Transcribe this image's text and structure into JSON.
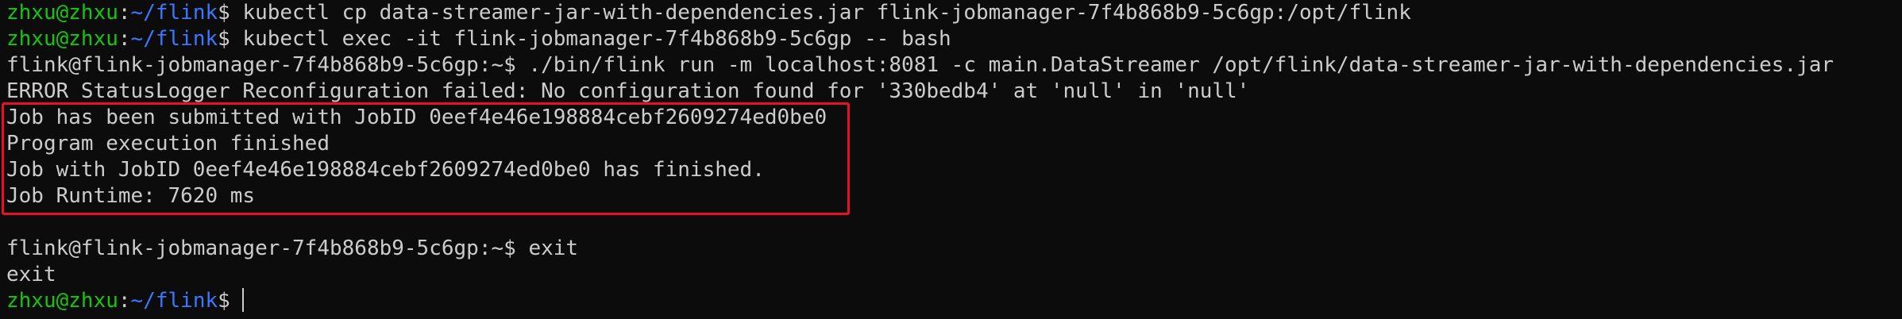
{
  "colors": {
    "background": "#0c0c0c",
    "text": "#cccccc",
    "prompt_user": "#16c60c",
    "prompt_path": "#3b78ff",
    "highlight_border": "#e81123"
  },
  "local_prompt": {
    "user": "zhxu@zhxu",
    "colon": ":",
    "path": "~/flink",
    "symbol": "$ "
  },
  "pod_prompt": "flink@flink-jobmanager-7f4b868b9-5c6gp:~$ ",
  "lines": {
    "l1_cmd": "kubectl cp data-streamer-jar-with-dependencies.jar flink-jobmanager-7f4b868b9-5c6gp:/opt/flink",
    "l2_cmd": "kubectl exec -it flink-jobmanager-7f4b868b9-5c6gp -- bash",
    "l3_cmd": "./bin/flink run -m localhost:8081 -c main.DataStreamer /opt/flink/data-streamer-jar-with-dependencies.jar",
    "l4_error": "ERROR StatusLogger Reconfiguration failed: No configuration found for '330bedb4' at 'null' in 'null'",
    "l5_submitted": "Job has been submitted with JobID 0eef4e46e198884cebf2609274ed0be0",
    "l6_finished": "Program execution finished",
    "l7_job_finished": "Job with JobID 0eef4e46e198884cebf2609274ed0be0 has finished.",
    "l8_runtime": "Job Runtime: 7620 ms",
    "l10_cmd": "exit",
    "l11_output": "exit"
  }
}
